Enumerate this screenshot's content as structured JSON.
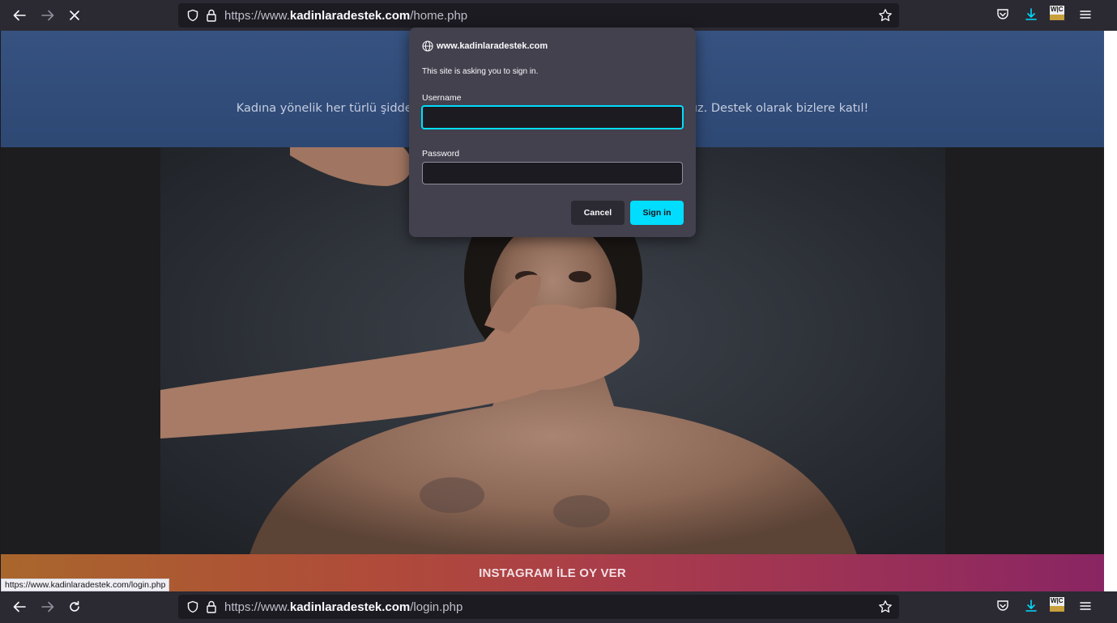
{
  "browser_top": {
    "url_prefix": "https://www.",
    "url_domain": "kadinlaradestek.com",
    "url_path": "/home.php"
  },
  "browser_bottom": {
    "url_prefix": "https://www.",
    "url_domain": "kadinlaradestek.com",
    "url_path": "/login.php"
  },
  "extension_badge": "W|C",
  "page": {
    "hero_text": "Kadına yönelik her türlü şiddetin karşısında ve her zaman kadınların yanındayız. Destek olarak bizlere katıl!",
    "vote_button": "INSTAGRAM İLE OY VER",
    "status_link": "https://www.kadinlaradestek.com/login.php"
  },
  "dialog": {
    "origin": "www.kadinlaradestek.com",
    "message": "This site is asking you to sign in.",
    "username_label": "Username",
    "username_value": "",
    "password_label": "Password",
    "password_value": "",
    "cancel_label": "Cancel",
    "signin_label": "Sign in"
  },
  "colors": {
    "accent": "#00ddff",
    "toolbar": "#2b2a33",
    "dialog": "#42414d",
    "hero": "#365280"
  }
}
